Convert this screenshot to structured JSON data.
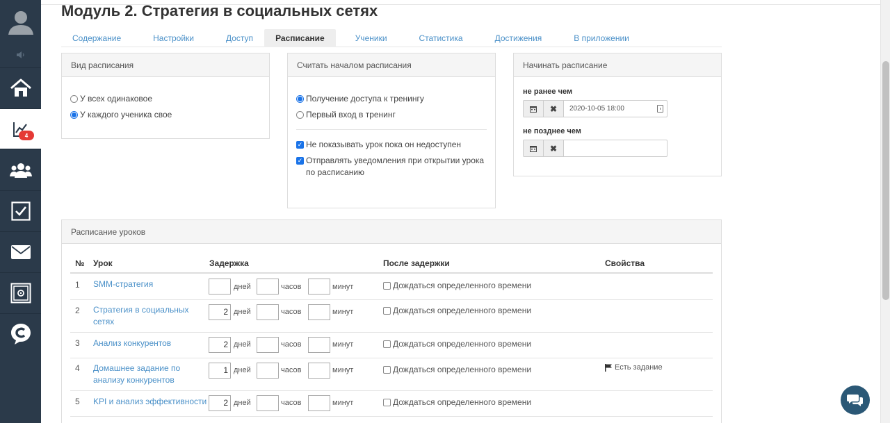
{
  "page": {
    "title": "Модуль 2. Стратегия в социальных сетях"
  },
  "sidebar": {
    "badge": "4",
    "items": [
      {
        "icon": "home-icon"
      },
      {
        "icon": "chart-icon",
        "active": true
      },
      {
        "icon": "users-icon"
      },
      {
        "icon": "tasks-icon"
      },
      {
        "icon": "mail-icon"
      },
      {
        "icon": "safe-icon"
      },
      {
        "icon": "brand-icon"
      }
    ]
  },
  "tabs": [
    {
      "label": "Содержание"
    },
    {
      "label": "Настройки"
    },
    {
      "label": "Доступ"
    },
    {
      "label": "Расписание",
      "active": true
    },
    {
      "label": "Ученики"
    },
    {
      "label": "Статистика"
    },
    {
      "label": "Достижения"
    },
    {
      "label": "В приложении"
    }
  ],
  "schedule_type": {
    "title": "Вид расписания",
    "options": [
      "У всех одинаковое",
      "У каждого ученика свое"
    ],
    "selected": 1
  },
  "schedule_start": {
    "title": "Считать началом расписания",
    "options": [
      "Получение доступа к тренингу",
      "Первый вход в тренинг"
    ],
    "selected": 0,
    "checks": [
      {
        "label": "Не показывать урок пока он недоступен",
        "checked": true
      },
      {
        "label": "Отправлять уведомления при открытии урока по расписанию",
        "checked": true
      }
    ]
  },
  "start_at": {
    "title": "Начинать расписание",
    "not_before_label": "не ранее чем",
    "not_before_value": "2020-10-05 18:00",
    "not_after_label": "не позднее чем",
    "not_after_value": ""
  },
  "lessons": {
    "title": "Расписание уроков",
    "columns": {
      "num": "№",
      "lesson": "Урок",
      "delay": "Задержка",
      "after": "После задержки",
      "props": "Свойства"
    },
    "units": {
      "days": "дней",
      "hours": "часов",
      "minutes": "минут"
    },
    "after_label": "Дождаться определенного времени",
    "rows": [
      {
        "num": "1",
        "title": "SMM-стратегия",
        "days": "",
        "hours": "",
        "minutes": "",
        "prop": ""
      },
      {
        "num": "2",
        "title": "Стратегия в социальных сетях",
        "days": "2",
        "hours": "",
        "minutes": "",
        "prop": ""
      },
      {
        "num": "3",
        "title": "Анализ конкурентов",
        "days": "2",
        "hours": "",
        "minutes": "",
        "prop": ""
      },
      {
        "num": "4",
        "title": "Домашнее задание по анализу конкурентов",
        "days": "1",
        "hours": "",
        "minutes": "",
        "prop": "Есть задание"
      },
      {
        "num": "5",
        "title": "KPI и анализ эффективности",
        "days": "2",
        "hours": "",
        "minutes": "",
        "prop": ""
      }
    ]
  }
}
